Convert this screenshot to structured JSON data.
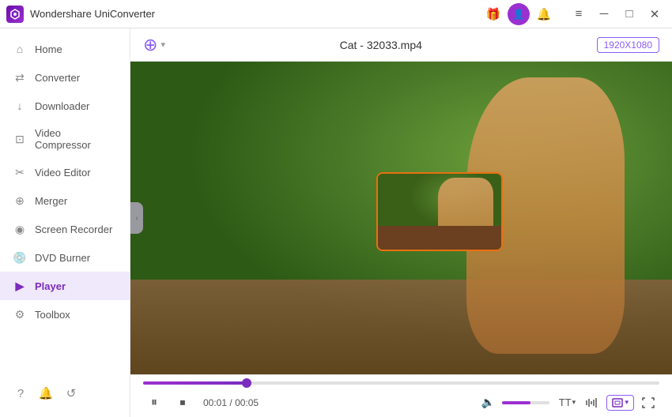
{
  "app": {
    "title": "Wondershare UniConverter",
    "logo_icon": "uniconverter-logo"
  },
  "titlebar": {
    "title": "Wondershare UniConverter",
    "gift_icon": "gift-icon",
    "user_icon": "user-icon",
    "notification_icon": "notification-icon",
    "menu_icon": "menu-icon",
    "minimize_icon": "minimize-icon",
    "maximize_icon": "maximize-icon",
    "close_icon": "close-icon"
  },
  "sidebar": {
    "items": [
      {
        "id": "home",
        "label": "Home",
        "icon": "home-icon"
      },
      {
        "id": "converter",
        "label": "Converter",
        "icon": "converter-icon"
      },
      {
        "id": "downloader",
        "label": "Downloader",
        "icon": "downloader-icon"
      },
      {
        "id": "video-compressor",
        "label": "Video Compressor",
        "icon": "compress-icon"
      },
      {
        "id": "video-editor",
        "label": "Video Editor",
        "icon": "edit-icon"
      },
      {
        "id": "merger",
        "label": "Merger",
        "icon": "merger-icon"
      },
      {
        "id": "screen-recorder",
        "label": "Screen Recorder",
        "icon": "record-icon"
      },
      {
        "id": "dvd-burner",
        "label": "DVD Burner",
        "icon": "dvd-icon"
      },
      {
        "id": "player",
        "label": "Player",
        "icon": "player-icon",
        "active": true
      },
      {
        "id": "toolbox",
        "label": "Toolbox",
        "icon": "toolbox-icon"
      }
    ],
    "bottom_icons": [
      "help-icon",
      "bell-icon",
      "feedback-icon"
    ]
  },
  "player": {
    "add_file_icon": "add-file-icon",
    "filename": "Cat - 32033.mp4",
    "resolution": "1920X1080",
    "current_time": "00:01",
    "total_time": "00:05",
    "progress_pct": 20,
    "volume_pct": 60
  },
  "controls": {
    "pause_label": "⏸",
    "stop_label": "⏹",
    "time_separator": "/",
    "volume_icon": "volume-icon",
    "caption_icon": "caption-icon",
    "audio_icon": "audio-icon",
    "screen_fit_label": "⊞",
    "screen_fit_chevron": "▾",
    "fullscreen_icon": "fullscreen-icon"
  }
}
